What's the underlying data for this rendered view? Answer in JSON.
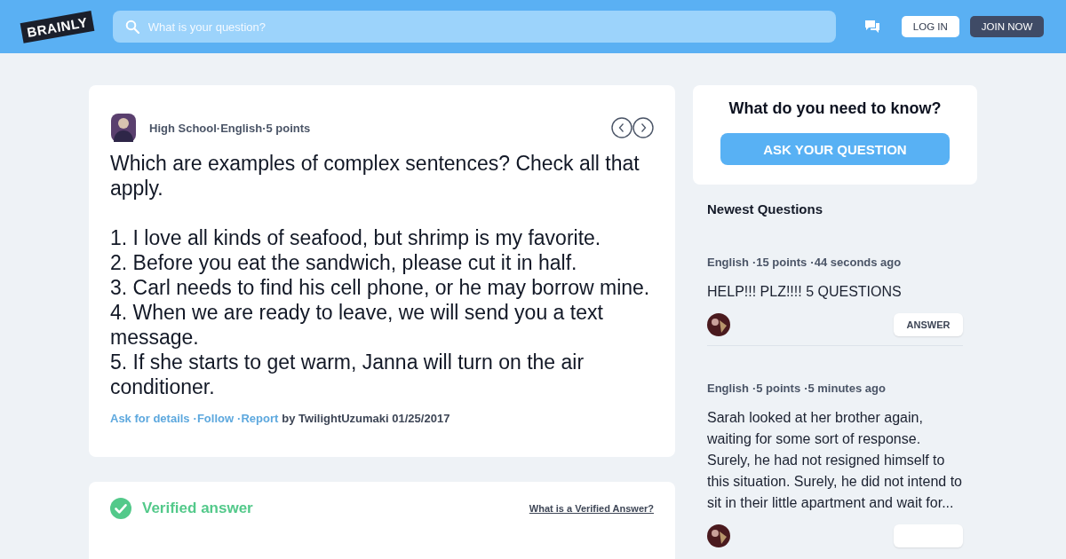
{
  "header": {
    "logo": "BRAINLY",
    "search": {
      "placeholder": "What is your question?"
    },
    "buttons": [
      {
        "label": "LOG IN",
        "kind": "outline"
      },
      {
        "label": "JOIN NOW",
        "kind": "dark"
      }
    ]
  },
  "question": {
    "meta": [
      "High School",
      "·English",
      "·5 points"
    ],
    "text": "Which are examples of complex sentences? Check all that apply.\n\n1. I love all kinds of seafood, but shrimp is my favorite.\n2. Before you eat the sandwich, please cut it in half.\n3. Carl needs to find his cell phone, or he may borrow mine.\n4. When we are ready to leave, we will send you a text message.\n5. If she starts to get warm, Janna will turn on the air conditioner.",
    "actions": [
      "Ask for details",
      "·Follow",
      "·Report"
    ],
    "author": "by TwilightUzumaki 01/25/2017"
  },
  "verified": {
    "title": "Verified answer",
    "link": "What is a Verified Answer?"
  },
  "ask_box": {
    "title": "What do you need to know?",
    "button": "ASK YOUR QUESTION"
  },
  "newest": {
    "title": "Newest Questions",
    "items": [
      {
        "meta": [
          "English",
          "·15 points",
          "·44 seconds ago"
        ],
        "text": "HELP!!! PLZ!!!! 5 QUESTIONS",
        "answer": "ANSWER"
      },
      {
        "meta": [
          "English",
          "·5 points",
          "·5 minutes ago"
        ],
        "text": "Sarah looked at her brother again, waiting for some sort of response. Surely, he had not resigned himself to this situation. Surely, he did not intend to sit in their little apartment and wait for..."
      }
    ]
  }
}
